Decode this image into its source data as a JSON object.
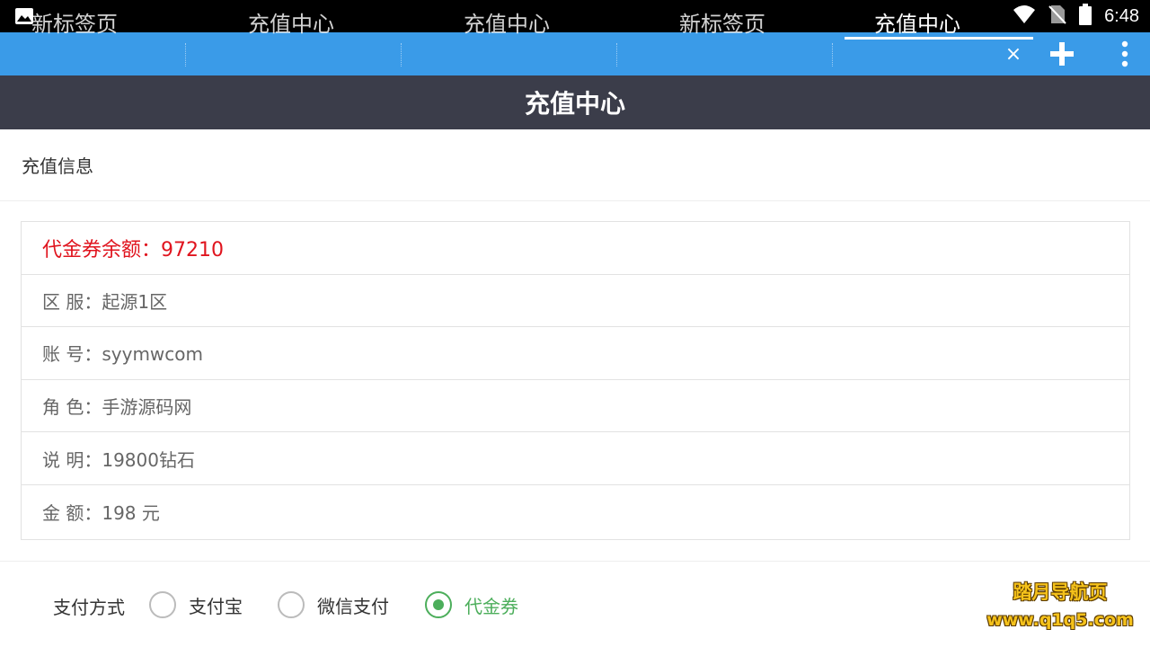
{
  "status_bar": {
    "time": "6:48",
    "icons": [
      "image-icon",
      "wifi-icon",
      "no-sim-icon",
      "battery-icon"
    ]
  },
  "tabs": [
    {
      "label": "新标签页",
      "active": false
    },
    {
      "label": "充值中心",
      "active": false
    },
    {
      "label": "充值中心",
      "active": false
    },
    {
      "label": "新标签页",
      "active": false
    },
    {
      "label": "充值中心",
      "active": true
    }
  ],
  "tab_controls": {
    "close_symbol": "×",
    "new_tab_icon": "plus-icon",
    "menu_icon": "more-vert-icon"
  },
  "header": {
    "title": "充值中心"
  },
  "section": {
    "title": "充值信息"
  },
  "info": {
    "balance": "代金券余额：97210",
    "server": "区 服：起源1区",
    "account": "账 号：syymwcom",
    "role": "角 色：手游源码网",
    "description": "说 明：19800钻石",
    "amount": "金 额：198 元"
  },
  "payment": {
    "label": "支付方式",
    "options": [
      {
        "label": "支付宝",
        "selected": false
      },
      {
        "label": "微信支付",
        "selected": false
      },
      {
        "label": "代金券",
        "selected": true
      }
    ]
  },
  "watermark": {
    "line1": "踏月导航页",
    "line2": "www.q1q5.com"
  },
  "colors": {
    "tab_bar": "#3a9be8",
    "header": "#3b3d4a",
    "balance_red": "#e0141e",
    "selected_green": "#4cae5b"
  }
}
